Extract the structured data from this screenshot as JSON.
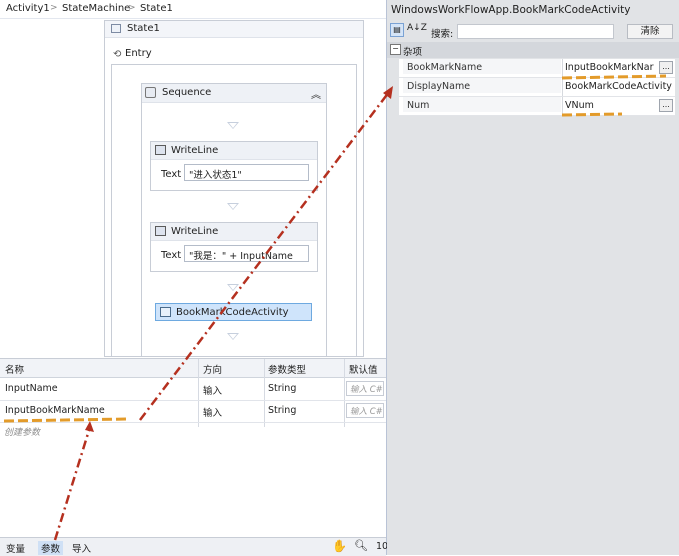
{
  "breadcrumb": [
    "Activity1",
    "StateMachine",
    "State1"
  ],
  "state": {
    "title": "State1",
    "entry_label": "Entry"
  },
  "sequence": {
    "title": "Sequence"
  },
  "activities": [
    {
      "title": "WriteLine",
      "field_label": "Text",
      "field_value": "\"进入状态1\""
    },
    {
      "title": "WriteLine",
      "field_label": "Text",
      "field_value": "\"我是：\" + InputName"
    }
  ],
  "bookmark_activity": {
    "title": "BookMarkCodeActivity"
  },
  "arguments": {
    "columns": [
      "名称",
      "方向",
      "参数类型",
      "默认值"
    ],
    "rows": [
      {
        "name": "InputName",
        "direction": "输入",
        "type": "String",
        "default_placeholder": "输入 C#"
      },
      {
        "name": "InputBookMarkName",
        "direction": "输入",
        "type": "String",
        "default_placeholder": "输入 C#"
      }
    ],
    "create_label": "创建参数"
  },
  "bottom_tabs": {
    "variables": "变量",
    "arguments": "参数",
    "imports": "导入",
    "zoom": "10"
  },
  "properties": {
    "title": "WindowsWorkFlowApp.BookMarkCodeActivity",
    "search_label": "搜索:",
    "clear_label": "清除",
    "category": "杂项",
    "rows": [
      {
        "name": "BookMarkName",
        "value": "InputBookMarkNar"
      },
      {
        "name": "DisplayName",
        "value": "BookMarkCodeActivity"
      },
      {
        "name": "Num",
        "value": "VNum"
      }
    ]
  },
  "annotation_colors": {
    "arrow": "#b5301f",
    "highlight": "#e39b2a"
  }
}
